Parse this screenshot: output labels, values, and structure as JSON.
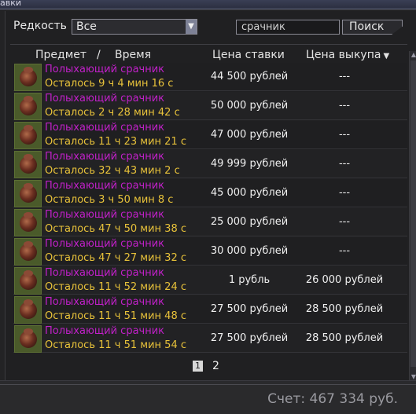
{
  "window": {
    "title": "авки"
  },
  "filters": {
    "rarity_label": "Редкость",
    "rarity_value": "Все",
    "search_value": "срачник",
    "search_button": "Поиск"
  },
  "columns": {
    "item": "Предмет",
    "separator": "/",
    "time": "Время",
    "bid": "Цена ставки",
    "buyout": "Цена выкупа",
    "buyout_sort_icon": "▼"
  },
  "rows": [
    {
      "name": "Полыхающий срачник",
      "time": "Осталось 9 ч 4 мин 16 с",
      "bid": "44 500 рублей",
      "buyout": "---"
    },
    {
      "name": "Полыхающий срачник",
      "time": "Осталось 2 ч 28 мин 42 с",
      "bid": "50 000 рублей",
      "buyout": "---"
    },
    {
      "name": "Полыхающий срачник",
      "time": "Осталось 11 ч 23 мин 21 с",
      "bid": "47 000 рублей",
      "buyout": "---"
    },
    {
      "name": "Полыхающий срачник",
      "time": "Осталось 32 ч 43 мин 2 с",
      "bid": "49 999 рублей",
      "buyout": "---"
    },
    {
      "name": "Полыхающий срачник",
      "time": "Осталось 3 ч 50 мин 8 с",
      "bid": "45 000 рублей",
      "buyout": "---"
    },
    {
      "name": "Полыхающий срачник",
      "time": "Осталось 47 ч 50 мин 38 с",
      "bid": "25 000 рублей",
      "buyout": "---"
    },
    {
      "name": "Полыхающий срачник",
      "time": "Осталось 47 ч 27 мин 32 с",
      "bid": "30 000 рублей",
      "buyout": "---"
    },
    {
      "name": "Полыхающий срачник",
      "time": "Осталось 11 ч 52 мин 24 с",
      "bid": "1 рубль",
      "buyout": "26 000 рублей"
    },
    {
      "name": "Полыхающий срачник",
      "time": "Осталось 11 ч 51 мин 48 с",
      "bid": "27 500 рублей",
      "buyout": "28 500 рублей"
    },
    {
      "name": "Полыхающий срачник",
      "time": "Осталось 11 ч 51 мин 54 с",
      "bid": "27 500 рублей",
      "buyout": "28 500 рублей"
    }
  ],
  "pagination": {
    "current": "1",
    "next": "2"
  },
  "footer": {
    "balance": "Счет: 467 334 руб."
  },
  "icons": {
    "item_icon": "item-thumbnail-icon",
    "select_arrow": "▼",
    "scroll_up": "▲",
    "scroll_down": "▼"
  },
  "colors": {
    "item_name": "#c020c8",
    "time_left": "#e8c23a",
    "text": "#f0f0f0",
    "background": "#202022"
  }
}
